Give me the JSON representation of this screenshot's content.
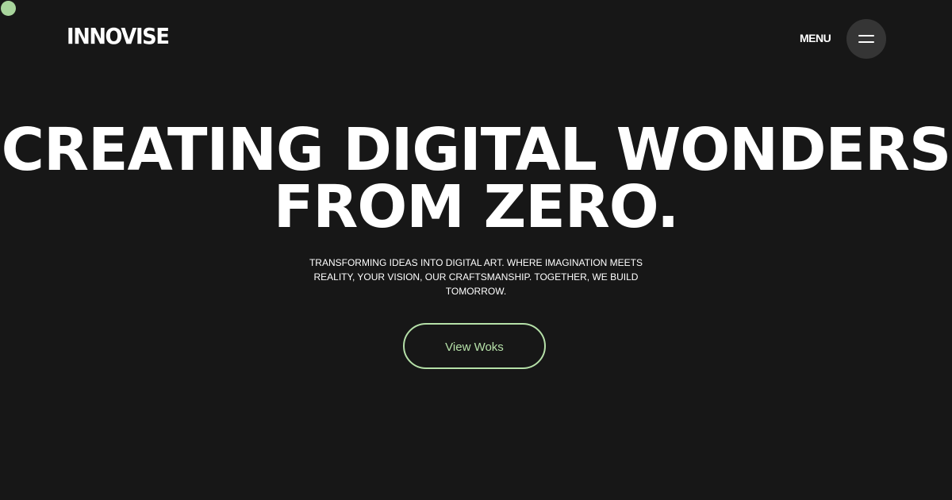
{
  "brand": {
    "logo_text": "INNOVISE"
  },
  "nav": {
    "menu_label": "MENU",
    "menu_icon": "hamburger-icon"
  },
  "hero": {
    "title_line1": "CREATING DIGITAL WONDERS",
    "title_line2": "FROM ZERO.",
    "subtitle": "TRANSFORMING IDEAS INTO DIGITAL ART. WHERE IMAGINATION MEETS REALITY, YOUR VISION, OUR CRAFTSMANSHIP. TOGETHER, WE BUILD TOMORROW.",
    "cta_label": "View Woks"
  },
  "colors": {
    "background": "#171717",
    "accent": "#b5e0a8",
    "cursor_dot": "#a8d59c",
    "menu_button_bg": "#353535",
    "text": "#ffffff"
  }
}
